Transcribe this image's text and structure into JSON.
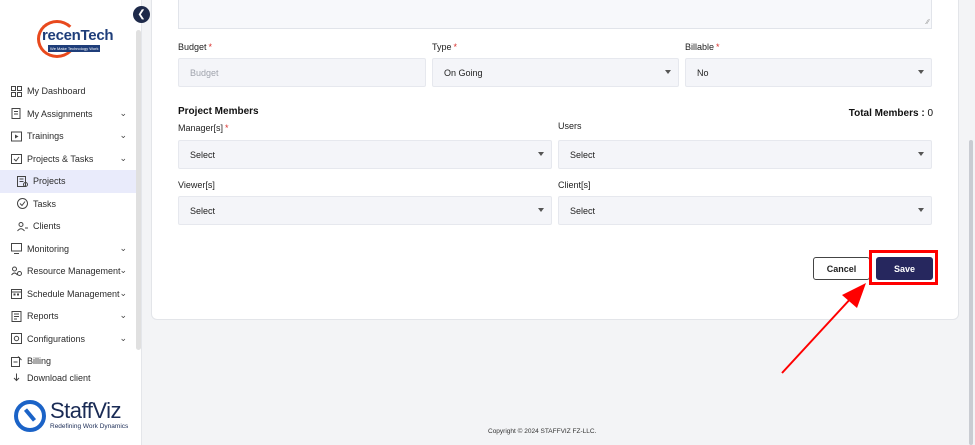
{
  "brand": {
    "company_word": "recenTech",
    "company_tagline": "We Make Technology Work",
    "product_name": "StaffViz",
    "product_slogan": "Redefining Work Dynamics"
  },
  "sidebar": {
    "items": [
      {
        "label": "My Dashboard",
        "icon": "dashboard-icon",
        "chevron": false
      },
      {
        "label": "My Assignments",
        "icon": "assignment-icon",
        "chevron": true
      },
      {
        "label": "Trainings",
        "icon": "play-icon",
        "chevron": true
      },
      {
        "label": "Projects & Tasks",
        "icon": "projects-icon",
        "chevron": true
      },
      {
        "label": "Projects",
        "icon": "project-list-icon",
        "sub": true,
        "active": true
      },
      {
        "label": "Tasks",
        "icon": "check-circle-icon",
        "sub": true
      },
      {
        "label": "Clients",
        "icon": "clients-icon",
        "sub": true
      },
      {
        "label": "Monitoring",
        "icon": "monitor-icon",
        "chevron": true
      },
      {
        "label": "Resource Management",
        "icon": "resource-icon",
        "chevron": true
      },
      {
        "label": "Schedule Management",
        "icon": "schedule-icon",
        "chevron": true
      },
      {
        "label": "Reports",
        "icon": "report-icon",
        "chevron": true
      },
      {
        "label": "Configurations",
        "icon": "config-icon",
        "chevron": true
      },
      {
        "label": "Billing",
        "icon": "billing-icon",
        "chevron": false
      },
      {
        "label": "Download client",
        "icon": "download-icon",
        "chevron": false
      }
    ]
  },
  "form": {
    "budget": {
      "label": "Budget",
      "placeholder": "Budget"
    },
    "type": {
      "label": "Type",
      "value": "On Going"
    },
    "billable": {
      "label": "Billable",
      "value": "No"
    },
    "members_title": "Project Members",
    "total_members_label": "Total Members :",
    "total_members_count": "0",
    "managers": {
      "label": "Manager[s]",
      "value": "Select"
    },
    "users": {
      "label": "Users",
      "value": "Select"
    },
    "viewers": {
      "label": "Viewer[s]",
      "value": "Select"
    },
    "clients": {
      "label": "Client[s]",
      "value": "Select"
    },
    "required_mark": "*"
  },
  "actions": {
    "cancel_label": "Cancel",
    "save_label": "Save"
  },
  "footer": {
    "copyright": "Copyright © 2024 STAFFVIZ FZ-LLC."
  },
  "colors": {
    "save_button": "#26275e",
    "highlight": "#ff0000",
    "required": "#d9302c",
    "active_item": "#e9ebfb"
  }
}
